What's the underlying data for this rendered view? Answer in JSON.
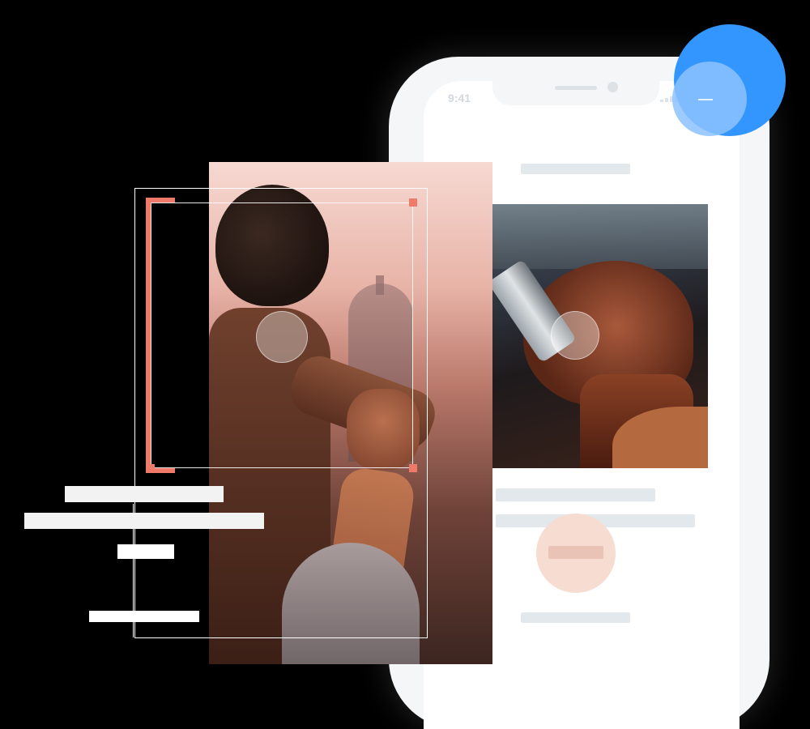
{
  "phone": {
    "status_time": "9:41"
  },
  "colors": {
    "accent_coral": "#f07a6a",
    "accent_blue": "#3396ff",
    "skeleton": "#e3e8ed",
    "background": "#000000"
  },
  "icons": {
    "status_signal": "signal-bars-icon",
    "crop_handles": "crop-handle-icon"
  }
}
